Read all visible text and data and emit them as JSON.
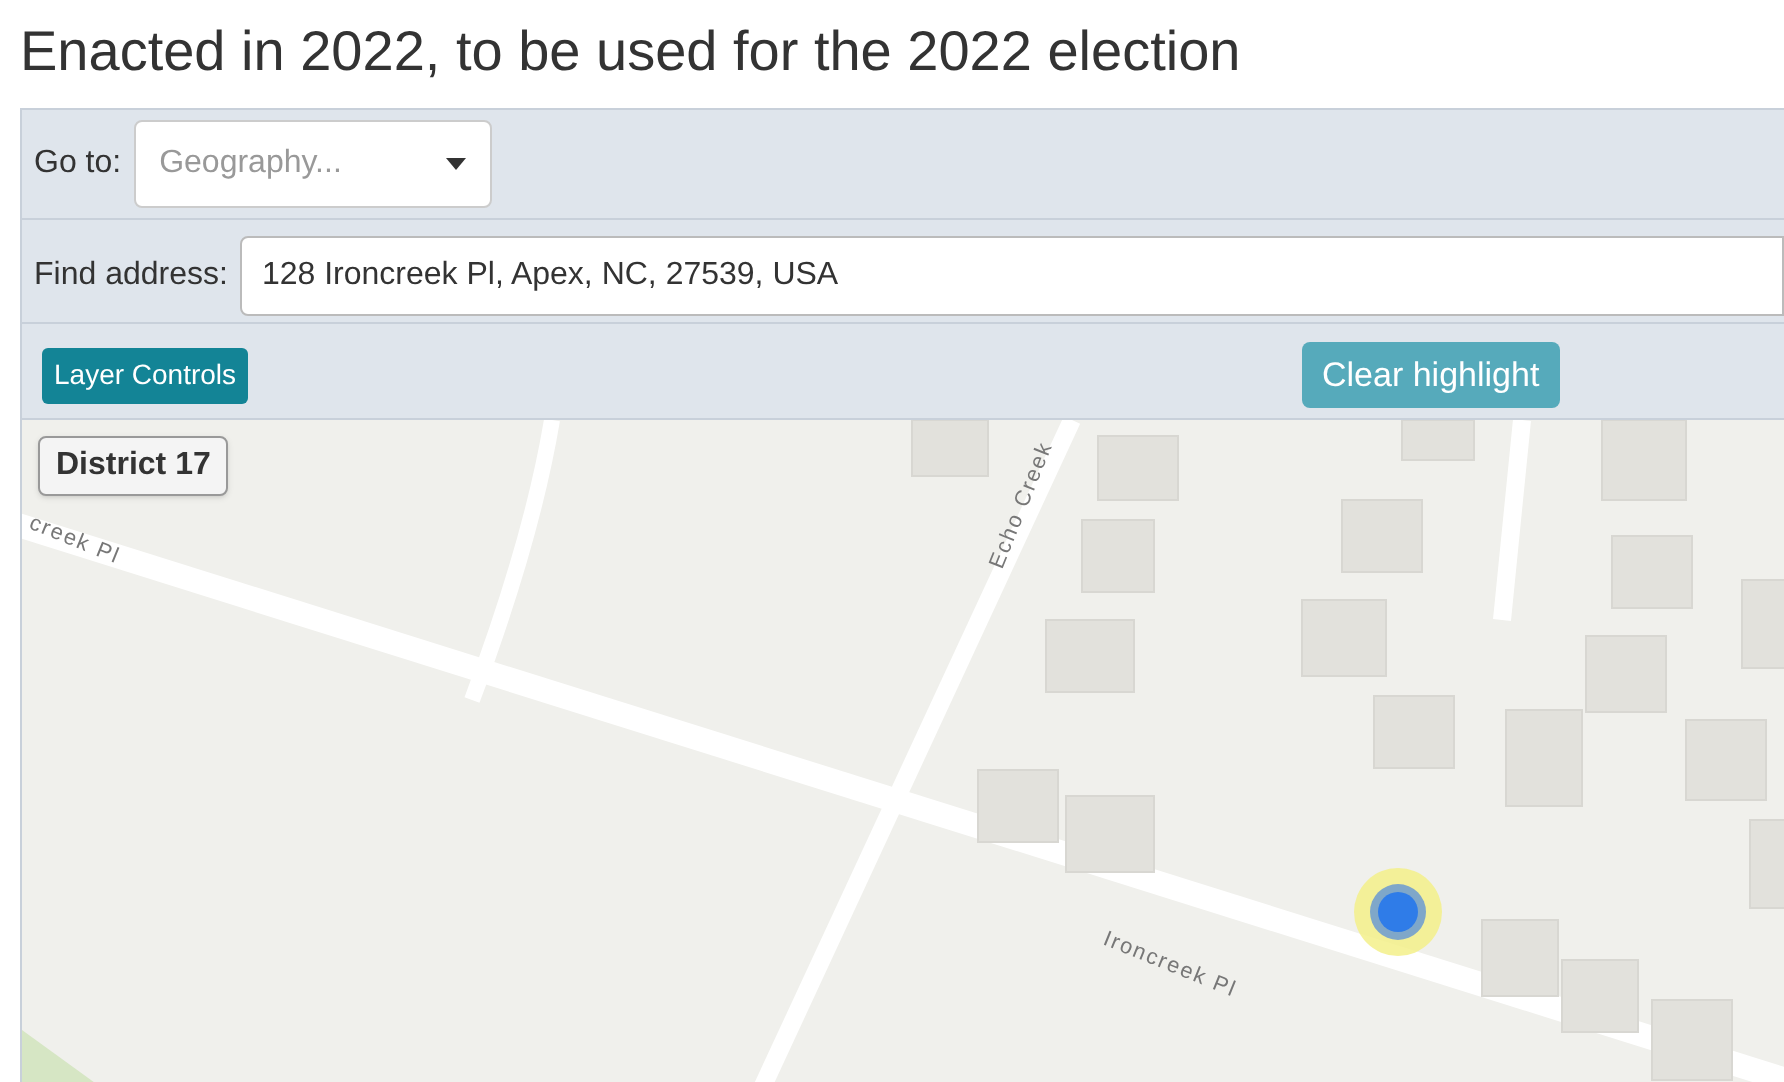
{
  "title": "Enacted in 2022, to be used for the 2022 election",
  "goto": {
    "label": "Go to:",
    "placeholder": "Geography..."
  },
  "find_address": {
    "label": "Find address:",
    "value": "128 Ironcreek Pl, Apex, NC, 27539, USA"
  },
  "buttons": [
    {
      "label": "Layer Controls",
      "kind": "primary"
    },
    {
      "label": "Clear highlight",
      "kind": "secondary"
    }
  ],
  "map": {
    "district_label": "District 17",
    "street_labels": [
      {
        "text": "creek Pl",
        "kind": "left"
      },
      {
        "text": "Echo Creek",
        "kind": "vertical"
      },
      {
        "text": "Ironcreek Pl",
        "kind": "right"
      }
    ]
  }
}
